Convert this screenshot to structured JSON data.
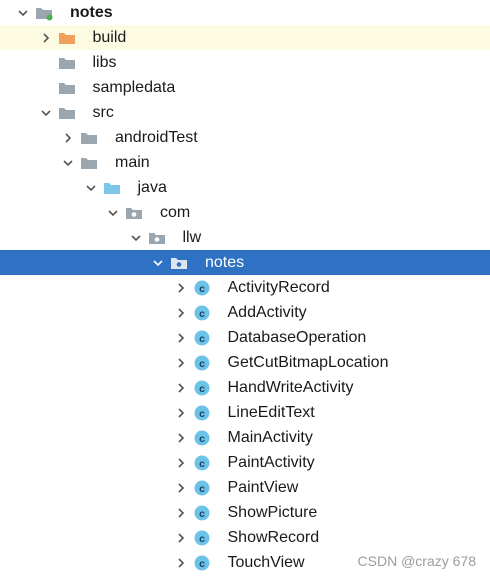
{
  "tree": {
    "items": [
      {
        "label": "notes",
        "icon": "module-folder-icon",
        "arrow": "expanded",
        "depth": 0,
        "bold": true,
        "state": "normal"
      },
      {
        "label": "build",
        "icon": "excluded-folder-icon",
        "arrow": "collapsed",
        "depth": 1,
        "state": "highlighted"
      },
      {
        "label": "libs",
        "icon": "folder-icon",
        "arrow": "none",
        "depth": 1,
        "state": "normal"
      },
      {
        "label": "sampledata",
        "icon": "folder-icon",
        "arrow": "none",
        "depth": 1,
        "state": "normal"
      },
      {
        "label": "src",
        "icon": "folder-icon",
        "arrow": "expanded",
        "depth": 1,
        "state": "normal"
      },
      {
        "label": "androidTest",
        "icon": "folder-icon",
        "arrow": "collapsed",
        "depth": 2,
        "state": "normal"
      },
      {
        "label": "main",
        "icon": "folder-icon",
        "arrow": "expanded",
        "depth": 2,
        "state": "normal"
      },
      {
        "label": "java",
        "icon": "source-folder-icon",
        "arrow": "expanded",
        "depth": 3,
        "state": "normal"
      },
      {
        "label": "com",
        "icon": "package-icon",
        "arrow": "expanded",
        "depth": 4,
        "state": "normal"
      },
      {
        "label": "llw",
        "icon": "package-icon",
        "arrow": "expanded",
        "depth": 5,
        "state": "normal"
      },
      {
        "label": "notes",
        "icon": "package-icon",
        "arrow": "expanded",
        "depth": 6,
        "state": "selected"
      },
      {
        "label": "ActivityRecord",
        "icon": "java-class-icon",
        "arrow": "collapsed",
        "depth": 7,
        "state": "normal"
      },
      {
        "label": "AddActivity",
        "icon": "java-class-icon",
        "arrow": "collapsed",
        "depth": 7,
        "state": "normal"
      },
      {
        "label": "DatabaseOperation",
        "icon": "java-class-icon",
        "arrow": "collapsed",
        "depth": 7,
        "state": "normal"
      },
      {
        "label": "GetCutBitmapLocation",
        "icon": "java-class-icon",
        "arrow": "collapsed",
        "depth": 7,
        "state": "normal"
      },
      {
        "label": "HandWriteActivity",
        "icon": "java-class-icon",
        "arrow": "collapsed",
        "depth": 7,
        "state": "normal"
      },
      {
        "label": "LineEditText",
        "icon": "java-class-icon",
        "arrow": "collapsed",
        "depth": 7,
        "state": "normal"
      },
      {
        "label": "MainActivity",
        "icon": "java-class-icon",
        "arrow": "collapsed",
        "depth": 7,
        "state": "normal"
      },
      {
        "label": "PaintActivity",
        "icon": "java-class-icon",
        "arrow": "collapsed",
        "depth": 7,
        "state": "normal"
      },
      {
        "label": "PaintView",
        "icon": "java-class-icon",
        "arrow": "collapsed",
        "depth": 7,
        "state": "normal"
      },
      {
        "label": "ShowPicture",
        "icon": "java-class-icon",
        "arrow": "collapsed",
        "depth": 7,
        "state": "normal"
      },
      {
        "label": "ShowRecord",
        "icon": "java-class-icon",
        "arrow": "collapsed",
        "depth": 7,
        "state": "normal"
      },
      {
        "label": "TouchView",
        "icon": "java-class-icon",
        "arrow": "collapsed",
        "depth": 7,
        "state": "normal"
      }
    ]
  },
  "watermark": "CSDN @crazy 678",
  "colors": {
    "selection": "#2f72c4",
    "highlight": "#fdfbe2",
    "folder": "#9aa7b0",
    "excluded_folder": "#f0a05a",
    "source_folder": "#7cc6e8",
    "class_icon": "#6cc3e8",
    "module_badge": "#4caf50"
  }
}
